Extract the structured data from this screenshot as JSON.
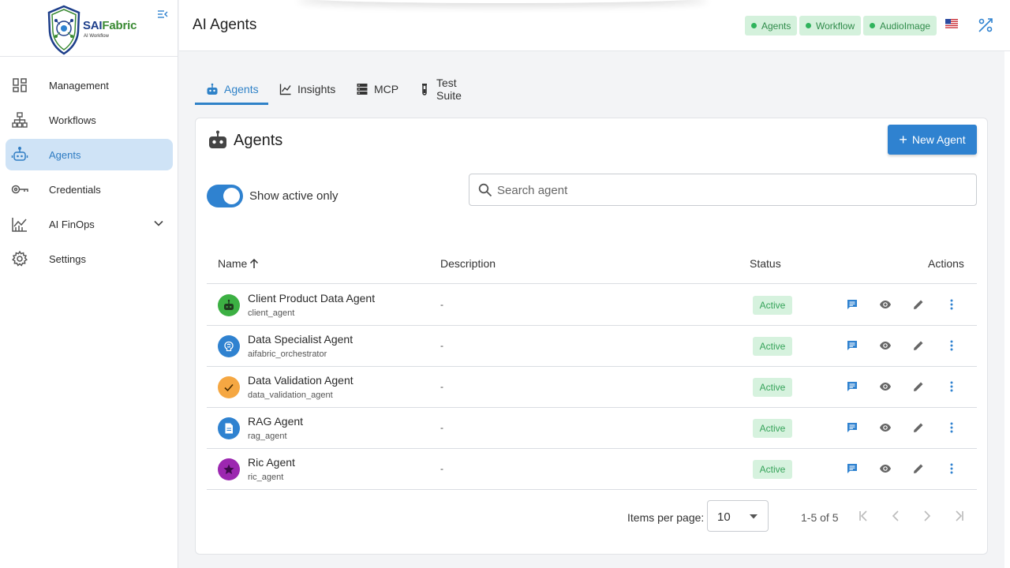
{
  "brand": {
    "name_main": "SAI",
    "name_accent": "Fabric",
    "tagline": "AI Workflow"
  },
  "sidebar": {
    "items": [
      {
        "label": "Management",
        "icon": "dashboard-icon"
      },
      {
        "label": "Workflows",
        "icon": "sitemap-icon"
      },
      {
        "label": "Agents",
        "icon": "robot-icon",
        "active": true
      },
      {
        "label": "Credentials",
        "icon": "key-icon"
      },
      {
        "label": "AI FinOps",
        "icon": "finops-chart-icon",
        "expandable": true
      },
      {
        "label": "Settings",
        "icon": "gear-icon"
      }
    ]
  },
  "header": {
    "title": "AI Agents",
    "chips": [
      "Agents",
      "Workflow",
      "AudioImage"
    ],
    "language_flag": "us-flag-icon",
    "tool_icon": "percent-tool-icon"
  },
  "tabs": [
    {
      "label": "Agents",
      "icon": "robot-icon",
      "active": true
    },
    {
      "label": "Insights",
      "icon": "line-chart-icon"
    },
    {
      "label": "MCP",
      "icon": "server-icon"
    },
    {
      "label": "Test Suite",
      "icon": "test-tube-icon"
    }
  ],
  "card": {
    "title": "Agents",
    "new_button": "New Agent",
    "toggle_label": "Show active only",
    "toggle_on": true,
    "search_placeholder": "Search agent"
  },
  "table": {
    "columns": {
      "name": "Name",
      "description": "Description",
      "status": "Status",
      "actions": "Actions"
    },
    "sort": {
      "column": "Name",
      "direction": "ascending"
    },
    "rows": [
      {
        "name": "Client Product Data Agent",
        "id": "client_agent",
        "description": "-",
        "status": "Active",
        "avatar_color": "#3cb043",
        "avatar_icon": "robot-icon"
      },
      {
        "name": "Data Specialist Agent",
        "id": "aifabric_orchestrator",
        "description": "-",
        "status": "Active",
        "avatar_color": "#2f82d0",
        "avatar_icon": "brain-icon"
      },
      {
        "name": "Data Validation Agent",
        "id": "data_validation_agent",
        "description": "-",
        "status": "Active",
        "avatar_color": "#f5a742",
        "avatar_icon": "checkmark-icon"
      },
      {
        "name": "RAG Agent",
        "id": "rag_agent",
        "description": "-",
        "status": "Active",
        "avatar_color": "#2f82d0",
        "avatar_icon": "document-icon"
      },
      {
        "name": "Ric Agent",
        "id": "ric_agent",
        "description": "-",
        "status": "Active",
        "avatar_color": "#9c27b0",
        "avatar_icon": "star-icon"
      }
    ]
  },
  "pagination": {
    "items_per_page_label": "Items per page:",
    "items_per_page": "10",
    "range": "1-5 of 5"
  },
  "colors": {
    "accent": "#2f82d0",
    "active_nav_bg": "#cfe3f6",
    "status_bg": "#d6f2de",
    "status_text": "#36a35a"
  }
}
